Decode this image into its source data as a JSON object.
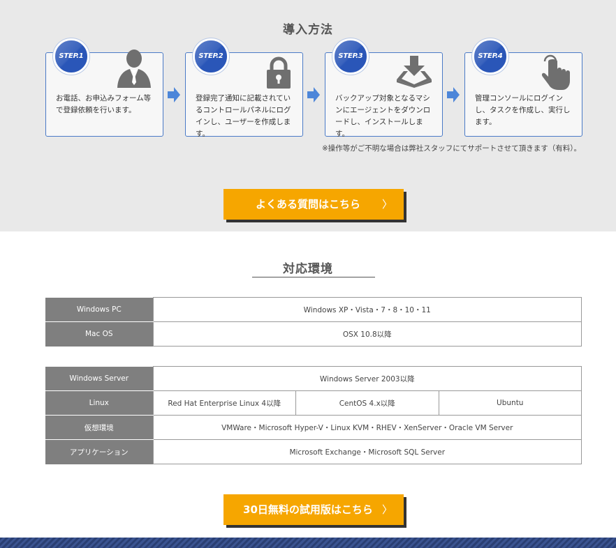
{
  "intro": {
    "title": "導入方法",
    "steps": [
      {
        "badge": "STEP.1",
        "icon": "person-icon",
        "text": "お電話、お申込みフォーム等で登録依頼を行います。"
      },
      {
        "badge": "STEP.2",
        "icon": "lock-icon",
        "text": "登録完了通知に記載されているコントロールパネルにログインし、ユーザーを作成します。"
      },
      {
        "badge": "STEP.3",
        "icon": "download-icon",
        "text": "バックアップ対象となるマシンにエージェントをダウンロードし、インストールします。"
      },
      {
        "badge": "STEP.4",
        "icon": "hand-pointer-icon",
        "text": "管理コンソールにログインし、タスクを作成し、実行します。"
      }
    ],
    "note": "※操作等がご不明な場合は弊社スタッフにてサポートさせて頂きます（有料）。",
    "faq_button": "よくある質問はこちら",
    "chevron": "〉"
  },
  "environment": {
    "title": "対応環境",
    "client_table": [
      {
        "label": "Windows PC",
        "value": "Windows XP・Vista・7・8・10・11"
      },
      {
        "label": "Mac OS",
        "value": "OSX 10.8以降"
      }
    ],
    "server_table": {
      "windows_server": {
        "label": "Windows Server",
        "value": "Windows Server 2003以降"
      },
      "linux": {
        "label": "Linux",
        "values": [
          "Red Hat Enterprise Linux 4以降",
          "CentOS 4.x以降",
          "Ubuntu"
        ]
      },
      "virtual": {
        "label": "仮想環境",
        "value": "VMWare・Microsoft Hyper-V・Linux KVM・RHEV・XenServer・Oracle VM Server"
      },
      "application": {
        "label": "アプリケーション",
        "value": "Microsoft Exchange・Microsoft SQL Server"
      }
    },
    "trial_button": "30日無料の試用版はこちら"
  },
  "colors": {
    "accent_orange": "#f6a600",
    "step_blue": "#2a56b8",
    "table_header_gray": "#7f7f7f",
    "footer_navy": "#2a3f73"
  }
}
